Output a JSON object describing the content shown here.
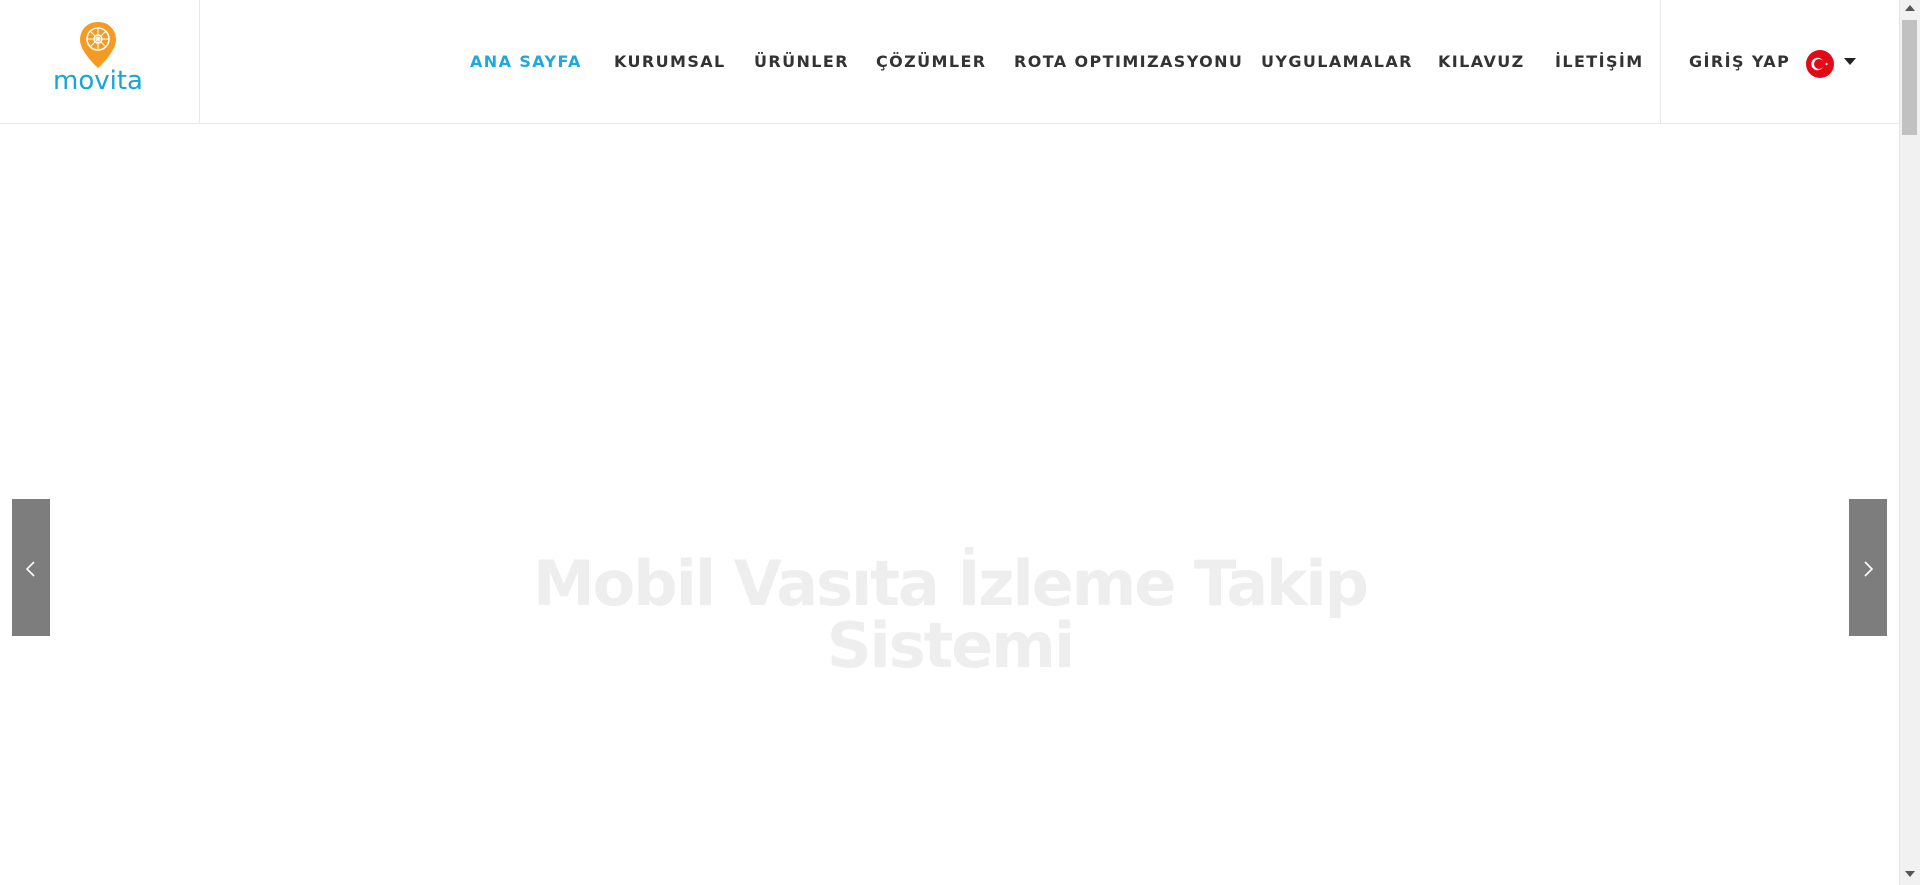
{
  "brand": {
    "name": "movita",
    "pin_color": "#f59a23",
    "text_color": "#17a5d8"
  },
  "nav": {
    "items": [
      {
        "label": "ANA SAYFA",
        "active": true
      },
      {
        "label": "KURUMSAL",
        "active": false
      },
      {
        "label": "ÜRÜNLER",
        "active": false
      },
      {
        "label": "ÇÖZÜMLER",
        "active": false
      },
      {
        "label": "ROTA OPTIMIZASYONU",
        "active": false
      },
      {
        "label": "UYGULAMALAR",
        "active": false
      },
      {
        "label": "KILAVUZ",
        "active": false
      },
      {
        "label": "İLETİŞİM",
        "active": false
      }
    ],
    "login_label": "GİRİŞ YAP",
    "language_icon": "turkey-flag-icon",
    "active_color": "#1fa8e0"
  },
  "hero": {
    "title_line1": "Mobil Vasıta İzleme Takip",
    "title_line2": "Sistemi",
    "prev_icon": "chevron-left-icon",
    "next_icon": "chevron-right-icon"
  }
}
